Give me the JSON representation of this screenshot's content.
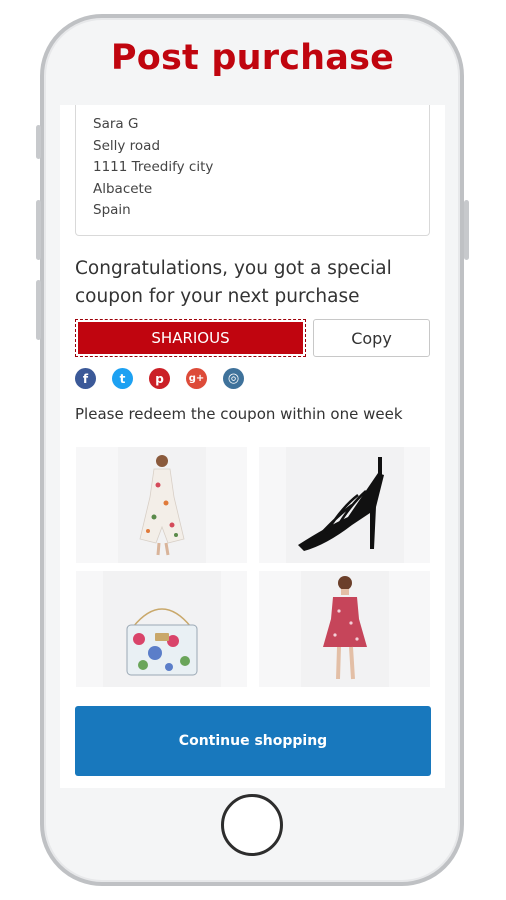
{
  "header": {
    "title": "Post purchase"
  },
  "address": {
    "lines": [
      "Sara G",
      "Selly road",
      "1111 Treedify city",
      "Albacete",
      "Spain"
    ]
  },
  "coupon": {
    "message": "Congratulations, you got a special coupon for your next purchase",
    "code": "SHARIOUS",
    "copy_label": "Copy",
    "redeem_note": "Please redeem the coupon within one week"
  },
  "social": [
    {
      "name": "facebook-icon",
      "glyph": "f",
      "color": "#3b5998"
    },
    {
      "name": "twitter-icon",
      "glyph": "t",
      "color": "#1da1f2"
    },
    {
      "name": "pinterest-icon",
      "glyph": "p",
      "color": "#cb2027"
    },
    {
      "name": "google-plus-icon",
      "glyph": "g+",
      "color": "#dd4b39"
    },
    {
      "name": "instagram-icon",
      "glyph": "◎",
      "color": "#3f729b"
    }
  ],
  "products": [
    {
      "name": "floral-dress-image"
    },
    {
      "name": "black-strappy-heels-image"
    },
    {
      "name": "floral-handbag-image"
    },
    {
      "name": "red-floral-dress-image"
    }
  ],
  "actions": {
    "continue_label": "Continue shopping"
  },
  "colors": {
    "brand_red": "#c0050f",
    "cta_blue": "#1878bd"
  }
}
